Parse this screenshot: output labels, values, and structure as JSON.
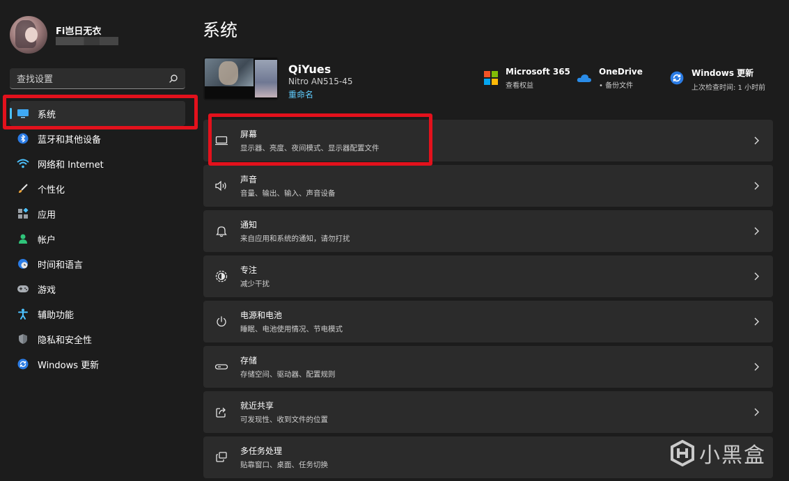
{
  "sidebar": {
    "user_name": "Fi岂日无衣",
    "search_placeholder": "查找设置",
    "items": [
      {
        "label": "系统",
        "icon": "monitor-icon",
        "selected": true
      },
      {
        "label": "蓝牙和其他设备",
        "icon": "bluetooth-icon"
      },
      {
        "label": "网络和 Internet",
        "icon": "wifi-icon"
      },
      {
        "label": "个性化",
        "icon": "brush-icon"
      },
      {
        "label": "应用",
        "icon": "apps-icon"
      },
      {
        "label": "帐户",
        "icon": "person-icon"
      },
      {
        "label": "时间和语言",
        "icon": "globe-clock-icon"
      },
      {
        "label": "游戏",
        "icon": "gamepad-icon"
      },
      {
        "label": "辅助功能",
        "icon": "accessibility-icon"
      },
      {
        "label": "隐私和安全性",
        "icon": "shield-icon"
      },
      {
        "label": "Windows 更新",
        "icon": "update-icon"
      }
    ]
  },
  "main": {
    "title": "系统",
    "device": {
      "name": "QiYues",
      "model": "Nitro AN515-45",
      "rename_label": "重命名"
    },
    "quick_links": [
      {
        "title": "Microsoft 365",
        "subtitle": "查看权益",
        "icon": "microsoft-logo-icon"
      },
      {
        "title": "OneDrive",
        "subtitle": "• 备份文件",
        "icon": "onedrive-cloud-icon"
      },
      {
        "title": "Windows 更新",
        "subtitle": "上次检查时间: 1 小时前",
        "icon": "windows-update-icon"
      }
    ],
    "cards": [
      {
        "title": "屏幕",
        "subtitle": "显示器、亮度、夜间模式、显示器配置文件",
        "icon": "display-icon"
      },
      {
        "title": "声音",
        "subtitle": "音量、输出、输入、声音设备",
        "icon": "speaker-icon"
      },
      {
        "title": "通知",
        "subtitle": "来自应用和系统的通知，请勿打扰",
        "icon": "bell-icon"
      },
      {
        "title": "专注",
        "subtitle": "减少干扰",
        "icon": "focus-icon"
      },
      {
        "title": "电源和电池",
        "subtitle": "睡眠、电池使用情况、节电模式",
        "icon": "power-icon"
      },
      {
        "title": "存储",
        "subtitle": "存储空间、驱动器、配置规则",
        "icon": "storage-icon"
      },
      {
        "title": "就近共享",
        "subtitle": "可发现性、收到文件的位置",
        "icon": "share-icon"
      },
      {
        "title": "多任务处理",
        "subtitle": "贴靠窗口、桌面、任务切换",
        "icon": "multitask-icon"
      }
    ]
  },
  "watermark": {
    "text": "小黑盒"
  },
  "colors": {
    "background": "#1c1c1c",
    "card": "#2b2b2b",
    "accent": "#4cc2ff",
    "link": "#60cdff",
    "annotation_red": "#e3111c"
  }
}
